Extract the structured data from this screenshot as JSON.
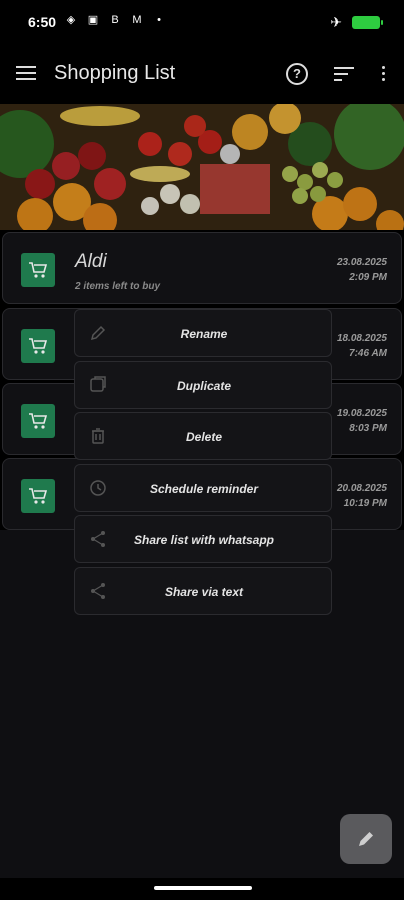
{
  "status_bar": {
    "time": "6:50"
  },
  "app_bar": {
    "title": "Shopping List"
  },
  "lists": [
    {
      "name": "Aldi",
      "subtitle": "2 items left to buy",
      "date": "23.08.2025",
      "time": "2:09 PM"
    },
    {
      "name": "",
      "subtitle": "",
      "date": "18.08.2025",
      "time": "7:46 AM"
    },
    {
      "name": "",
      "subtitle": "",
      "date": "19.08.2025",
      "time": "8:03 PM"
    },
    {
      "name": "",
      "subtitle": "",
      "date": "20.08.2025",
      "time": "10:19 PM"
    }
  ],
  "context_menu": {
    "items": [
      {
        "label": "Rename",
        "icon": "pencil-icon"
      },
      {
        "label": "Duplicate",
        "icon": "copy-icon"
      },
      {
        "label": "Delete",
        "icon": "trash-icon"
      },
      {
        "label": "Schedule reminder",
        "icon": "clock-icon"
      },
      {
        "label": "Share list with whatsapp",
        "icon": "share-icon"
      },
      {
        "label": "Share via text",
        "icon": "share-icon"
      }
    ]
  },
  "colors": {
    "accent": "#1f7a4d",
    "background": "#000000",
    "fab": "#5a5a5d"
  }
}
